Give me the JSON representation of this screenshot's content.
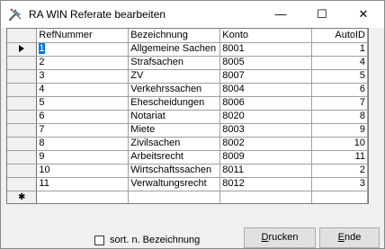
{
  "window": {
    "title": "RA WIN Referate bearbeiten",
    "minimize_glyph": "—",
    "maximize_glyph": "☐",
    "close_glyph": "✕"
  },
  "grid": {
    "columns": [
      "RefNummer",
      "Bezeichnung",
      "Konto",
      "AutoID"
    ],
    "rows": [
      [
        "1",
        "Allgemeine Sachen",
        "8001",
        "1"
      ],
      [
        "2",
        "Strafsachen",
        "8005",
        "4"
      ],
      [
        "3",
        "ZV",
        "8007",
        "5"
      ],
      [
        "4",
        "Verkehrssachen",
        "8004",
        "6"
      ],
      [
        "5",
        "Ehescheidungen",
        "8006",
        "7"
      ],
      [
        "6",
        "Notariat",
        "8020",
        "8"
      ],
      [
        "7",
        "Miete",
        "8003",
        "9"
      ],
      [
        "8",
        "Zivilsachen",
        "8002",
        "10"
      ],
      [
        "9",
        "Arbeitsrecht",
        "8009",
        "11"
      ],
      [
        "10",
        "Wirtschaftssachen",
        "8011",
        "2"
      ],
      [
        "11",
        "Verwaltungsrecht",
        "8012",
        "3"
      ]
    ],
    "new_row_marker": "✱"
  },
  "footer": {
    "sort_checkbox_label": "sort. n. Bezeichnung",
    "sort_checked": false,
    "print_button": {
      "accel": "D",
      "rest": "rucken"
    },
    "end_button": {
      "accel": "E",
      "rest": "nde"
    }
  },
  "colors": {
    "selection": "#0078d7",
    "grid_line": "#a0a0a0"
  }
}
